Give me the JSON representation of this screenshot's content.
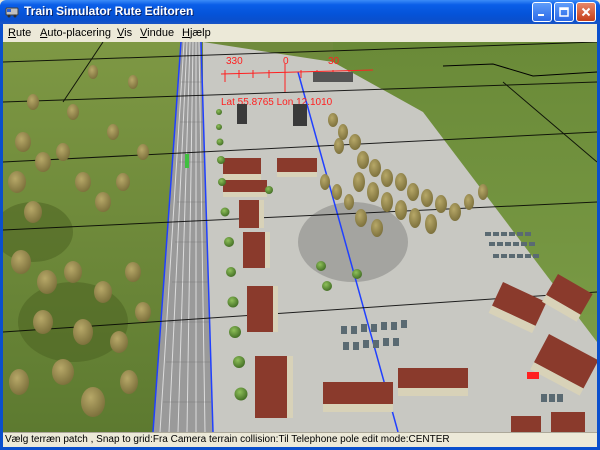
{
  "window": {
    "title": "Train Simulator Rute Editoren",
    "buttons": {
      "minimize": "_",
      "maximize": "□",
      "close": "✕"
    },
    "frame_color": "#0a4fcd"
  },
  "menu": {
    "items": [
      {
        "label": "Rute",
        "accel_index": 0
      },
      {
        "label": "Auto-placering",
        "accel_index": 0
      },
      {
        "label": "Vis",
        "accel_index": 0
      },
      {
        "label": "Vindue",
        "accel_index": 0
      },
      {
        "label": "Hjælp",
        "accel_index": 0
      }
    ]
  },
  "viewport": {
    "compass": {
      "heading_left": "330",
      "heading_center": "0",
      "heading_right": "30",
      "position_readout": "Lat 55.8765  Lon 12.1010",
      "color": "#ff2020"
    },
    "colors": {
      "grass_light": "#8aa14a",
      "grass_dark": "#5f7a2e",
      "yard_ground": "#c9c9c4",
      "track_blue": "#2040ff",
      "grid_line": "#000000"
    }
  },
  "status": {
    "text": "Vælg terræn patch , Snap to grid:Fra Camera terrain collision:Til Telephone pole edit mode:CENTER"
  }
}
